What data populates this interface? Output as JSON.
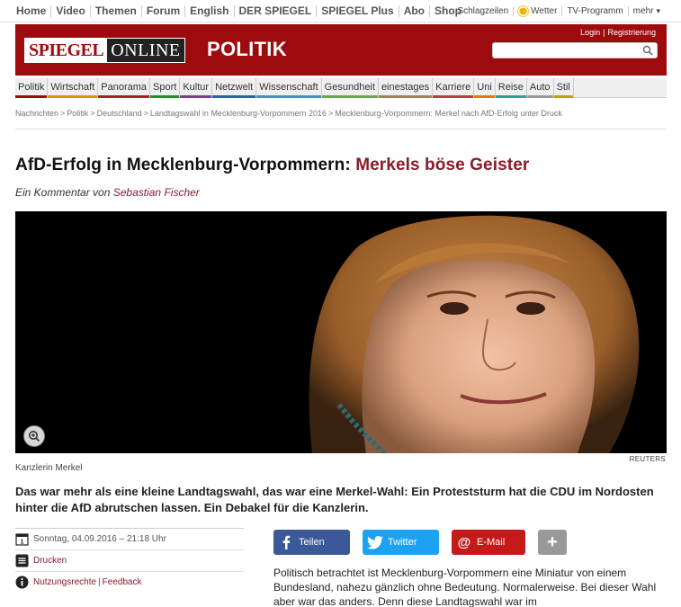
{
  "topnav": {
    "left": [
      "Home",
      "Video",
      "Themen",
      "Forum",
      "English",
      "DER SPIEGEL",
      "SPIEGEL Plus",
      "Abo",
      "Shop"
    ],
    "right": {
      "schlagzeilen": "Schlagzeilen",
      "wetter": "Wetter",
      "tv": "TV-Programm",
      "mehr": "mehr"
    }
  },
  "header": {
    "logo_spiegel": "SPIEGEL",
    "logo_online": "ONLINE",
    "section": "POLITIK",
    "login": "Login",
    "register": "Registrierung",
    "search_placeholder": ""
  },
  "channels": [
    {
      "label": "Politik",
      "color": "#9e0b0f"
    },
    {
      "label": "Wirtschaft",
      "color": "#d19a00"
    },
    {
      "label": "Panorama",
      "color": "#a61f2a"
    },
    {
      "label": "Sport",
      "color": "#2a8a2a"
    },
    {
      "label": "Kultur",
      "color": "#7a3f8f"
    },
    {
      "label": "Netzwelt",
      "color": "#2b62a6"
    },
    {
      "label": "Wissenschaft",
      "color": "#4a8fbf"
    },
    {
      "label": "Gesundheit",
      "color": "#6aa84f"
    },
    {
      "label": "einestages",
      "color": "#a08060"
    },
    {
      "label": "Karriere",
      "color": "#b33f40"
    },
    {
      "label": "Uni",
      "color": "#e07b00"
    },
    {
      "label": "Reise",
      "color": "#2aa198"
    },
    {
      "label": "Auto",
      "color": "#999999"
    },
    {
      "label": "Stil",
      "color": "#c0a000"
    }
  ],
  "breadcrumb": [
    "Nachrichten",
    "Politik",
    "Deutschland",
    "Landtagswahl in Mecklenburg-Vorpommern 2016",
    "Mecklenburg-Vorpommern: Merkel nach AfD-Erfolg unter Druck"
  ],
  "article": {
    "kicker": "AfD-Erfolg in Mecklenburg-Vorpommern:",
    "title": "Merkels böse Geister",
    "byline_prefix": "Ein Kommentar von",
    "author": "Sebastian Fischer",
    "caption": "Kanzlerin Merkel",
    "credit": "REUTERS",
    "intro": "Das war mehr als eine kleine Landtagswahl, das war eine Merkel-Wahl: Ein Proteststurm hat die CDU im Nordosten hinter die AfD abrutschen lassen. Ein Debakel für die Kanzlerin.",
    "body": "Politisch betrachtet ist Mecklenburg-Vorpommern eine Miniatur von einem Bundesland, nahezu gänzlich ohne Bedeutung. Normalerweise. Bei dieser Wahl aber war das anders. Denn diese Landtagswahl war im"
  },
  "meta": {
    "date": "Sonntag, 04.09.2016 – 21:18 Uhr",
    "print": "Drucken",
    "rights": "Nutzungsrechte",
    "feedback": "Feedback"
  },
  "share": {
    "facebook": "Teilen",
    "twitter": "Twitter",
    "email": "E-Mail",
    "more": "+"
  }
}
